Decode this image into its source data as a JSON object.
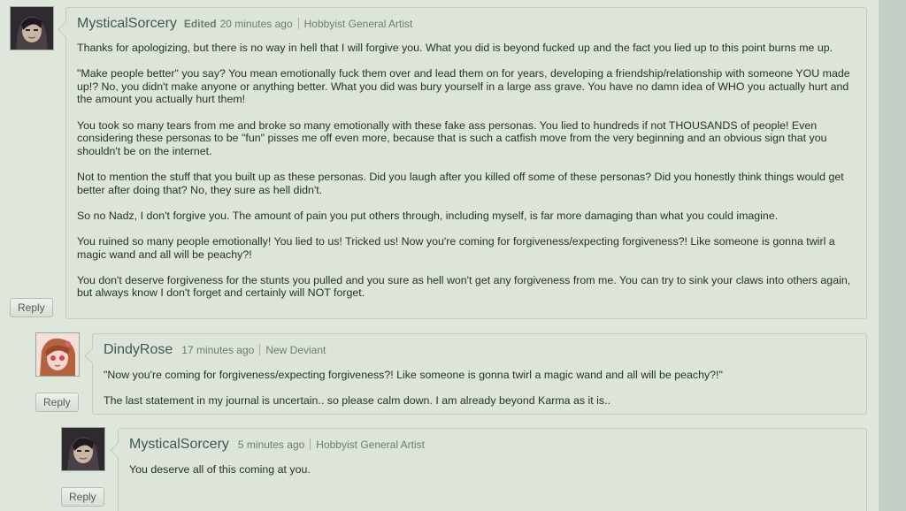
{
  "comments": [
    {
      "username": "MysticalSorcery",
      "edited": "Edited",
      "time": "20 minutes ago",
      "rank": "Hobbyist General Artist",
      "reply_label": "Reply",
      "paragraphs": [
        "Thanks for apologizing, but there is no way in hell that I will forgive you. What you did is beyond fucked up and the fact you lied up to this point burns me up.",
        "\"Make people better\" you say? You mean emotionally fuck them over and lead them on for years, developing a friendship/relationship with someone YOU made up!? No, you didn't make anyone or anything better. What you did was bury yourself in a large ass grave. You have no damn idea of WHO you actually hurt and the amount you actually hurt them!",
        "You took so many tears from me and broke so many emotionally with these fake ass personas. You lied to hundreds if not THOUSANDS of people! Even considering these personas to be \"fun\" pisses me off even more, because that is such a catfish move from the very beginning and an obvious sign that you shouldn't be on the internet.",
        "Not to mention the stuff that you built up as these personas. Did you laugh after you killed off some of these personas? Did you honestly think things would get better after doing that? No, they sure as hell didn't.",
        "So no Nadz, I don't forgive you. The amount of pain you put others through, including myself, is far more damaging than what you could imagine.",
        "You ruined so many people emotionally! You lied to us! Tricked us! Now you're coming for forgiveness/expecting forgiveness?! Like someone is gonna twirl a magic wand and all will be peachy?!",
        "You don't deserve forgiveness for the stunts you pulled and you sure as hell won't get any forgiveness from me. You can try to sink your claws into others again, but always know I don't forget and certainly will NOT forget."
      ]
    },
    {
      "username": "DindyRose",
      "time": "17 minutes ago",
      "rank": "New Deviant",
      "reply_label": "Reply",
      "paragraphs": [
        "\"Now you're coming for forgiveness/expecting forgiveness?! Like someone is gonna twirl a magic wand and all will be peachy?!\"",
        "The last statement in my journal is uncertain.. so please calm down. I am already beyond Karma as it is.."
      ]
    },
    {
      "username": "MysticalSorcery",
      "time": "5 minutes ago",
      "rank": "Hobbyist General Artist",
      "reply_label": "Reply",
      "paragraphs": [
        "You deserve all of this coming at you."
      ]
    }
  ],
  "colors": {
    "page_bg": "#dfe7dd",
    "card_bg": "#dde5da",
    "username": "#3b5a4e",
    "text": "#243428"
  }
}
